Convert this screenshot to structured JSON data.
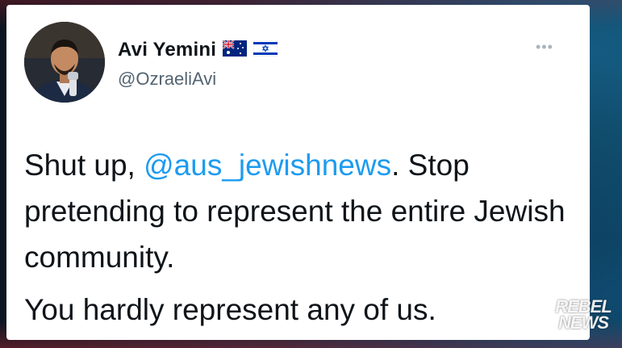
{
  "tweet": {
    "author": {
      "display_name": "Avi Yemini",
      "handle": "@OzraeliAvi",
      "flags": [
        "australia-flag-icon",
        "israel-flag-icon"
      ]
    },
    "more_label": "•••",
    "text": {
      "line1_before": "Shut up, ",
      "mention": "@aus_jewishnews",
      "line1_after": ". Stop pretending to represent the entire Jewish community.",
      "paragraph2": "You hardly represent any of us."
    }
  },
  "watermark": {
    "line1": "REBEL",
    "line2": "NEWS"
  },
  "colors": {
    "mention": "#1d9bf0",
    "text": "#0f1419",
    "secondary": "#536471"
  }
}
